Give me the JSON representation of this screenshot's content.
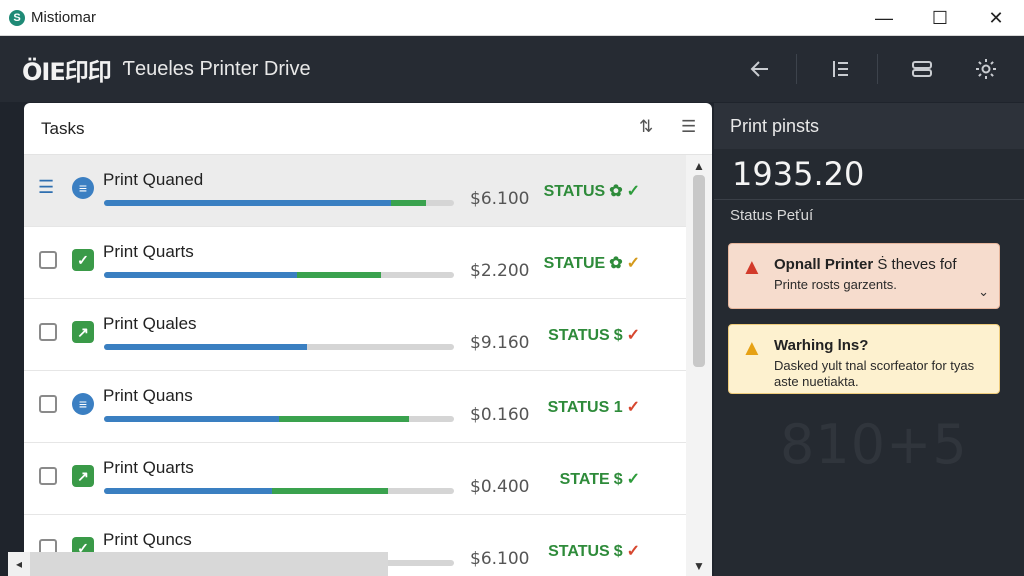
{
  "window": {
    "title": "Mistiomar",
    "icon": "app-logo-icon",
    "controls": {
      "minimize": "—",
      "maximize": "☐",
      "close": "✕"
    }
  },
  "header": {
    "logo_text": "ÖIE印印",
    "app_name": "Ƭeueles Printer Drive",
    "icons": [
      "back-arrow-icon",
      "list-view-icon",
      "panel-view-icon",
      "settings-icon"
    ]
  },
  "tasks": {
    "title": "Tasks",
    "tools": [
      "filter-icon",
      "menu-icon"
    ],
    "rows": [
      {
        "name": "Print Quaned",
        "price": "$6.100",
        "status": "STATUS",
        "status_glyph": "✿",
        "mark": "✓",
        "mark_kind": "ok",
        "progress_blue": 0.92,
        "progress_green_start": 0.82,
        "icon": "database-icon",
        "selected": true
      },
      {
        "name": "Print Quarts",
        "price": "$2.200",
        "status": "STATUE",
        "status_glyph": "✿",
        "mark": "✓",
        "mark_kind": "warn",
        "progress_blue": 0.79,
        "progress_green_start": 0.55,
        "icon": "check-square-icon",
        "selected": false
      },
      {
        "name": "Print Quales",
        "price": "$9.160",
        "status": "STATUS",
        "status_glyph": "$",
        "mark": "✓",
        "mark_kind": "err",
        "progress_blue": 0.58,
        "progress_green_start": 1.0,
        "icon": "chart-up-icon",
        "selected": false
      },
      {
        "name": "Print Quans",
        "price": "$0.160",
        "status": "STATUS 1",
        "status_glyph": "",
        "mark": "✓",
        "mark_kind": "err",
        "progress_blue": 0.87,
        "progress_green_start": 0.5,
        "icon": "stack-icon",
        "selected": false
      },
      {
        "name": "Print Quarts",
        "price": "$0.400",
        "status": "STATE",
        "status_glyph": "$",
        "mark": "✓",
        "mark_kind": "ok",
        "progress_blue": 0.81,
        "progress_green_start": 0.48,
        "icon": "chart-up-icon",
        "selected": false
      },
      {
        "name": "Print Quncs",
        "price": "$6.100",
        "status": "STATUS",
        "status_glyph": "$",
        "mark": "✓",
        "mark_kind": "err",
        "progress_blue": 0.0,
        "progress_green_start": 1.0,
        "icon": "check-square-icon",
        "selected": false
      }
    ]
  },
  "right_panel": {
    "title": "Print pinsts",
    "big_number": "1935.20",
    "status_label": "Status Peťuí",
    "alerts": [
      {
        "kind": "error",
        "title": "Opnall Printer",
        "title_rest": " Ṡ theves fof",
        "body": "Printe rosts garzents.",
        "icon": "error-triangle-icon"
      },
      {
        "kind": "warn",
        "title": "Warhing lns?",
        "title_rest": "",
        "body": "Dasked yult tnal scorfeator for tyas aste nuetiakta.",
        "icon": "warning-triangle-icon"
      }
    ],
    "watermark": "810+5"
  },
  "colors": {
    "accent_blue": "#3a7fc1",
    "accent_green": "#3aa24e",
    "status_green": "#2e8b3a",
    "error_red": "#d23a2a",
    "warn_amber": "#e6a114"
  }
}
